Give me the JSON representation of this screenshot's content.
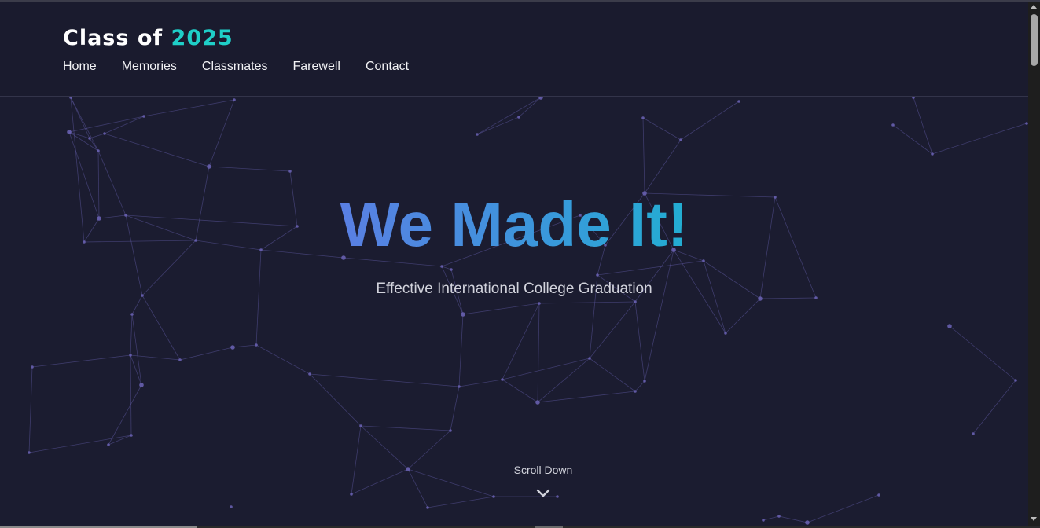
{
  "site": {
    "logo_prefix": "Class of ",
    "logo_year": "2025"
  },
  "nav": {
    "items": [
      "Home",
      "Memories",
      "Classmates",
      "Farewell",
      "Contact"
    ]
  },
  "hero": {
    "title": "We Made It!",
    "subtitle": "Effective International College Graduation",
    "scroll_label": "Scroll Down"
  },
  "colors": {
    "background": "#1a1b2e",
    "accent_year": "#1fcfc8",
    "title_gradient": [
      "#5a7fe3",
      "#22aed2"
    ],
    "network_line": "#6b63b5"
  },
  "icons": {
    "scroll": "chevron-down-icon"
  }
}
